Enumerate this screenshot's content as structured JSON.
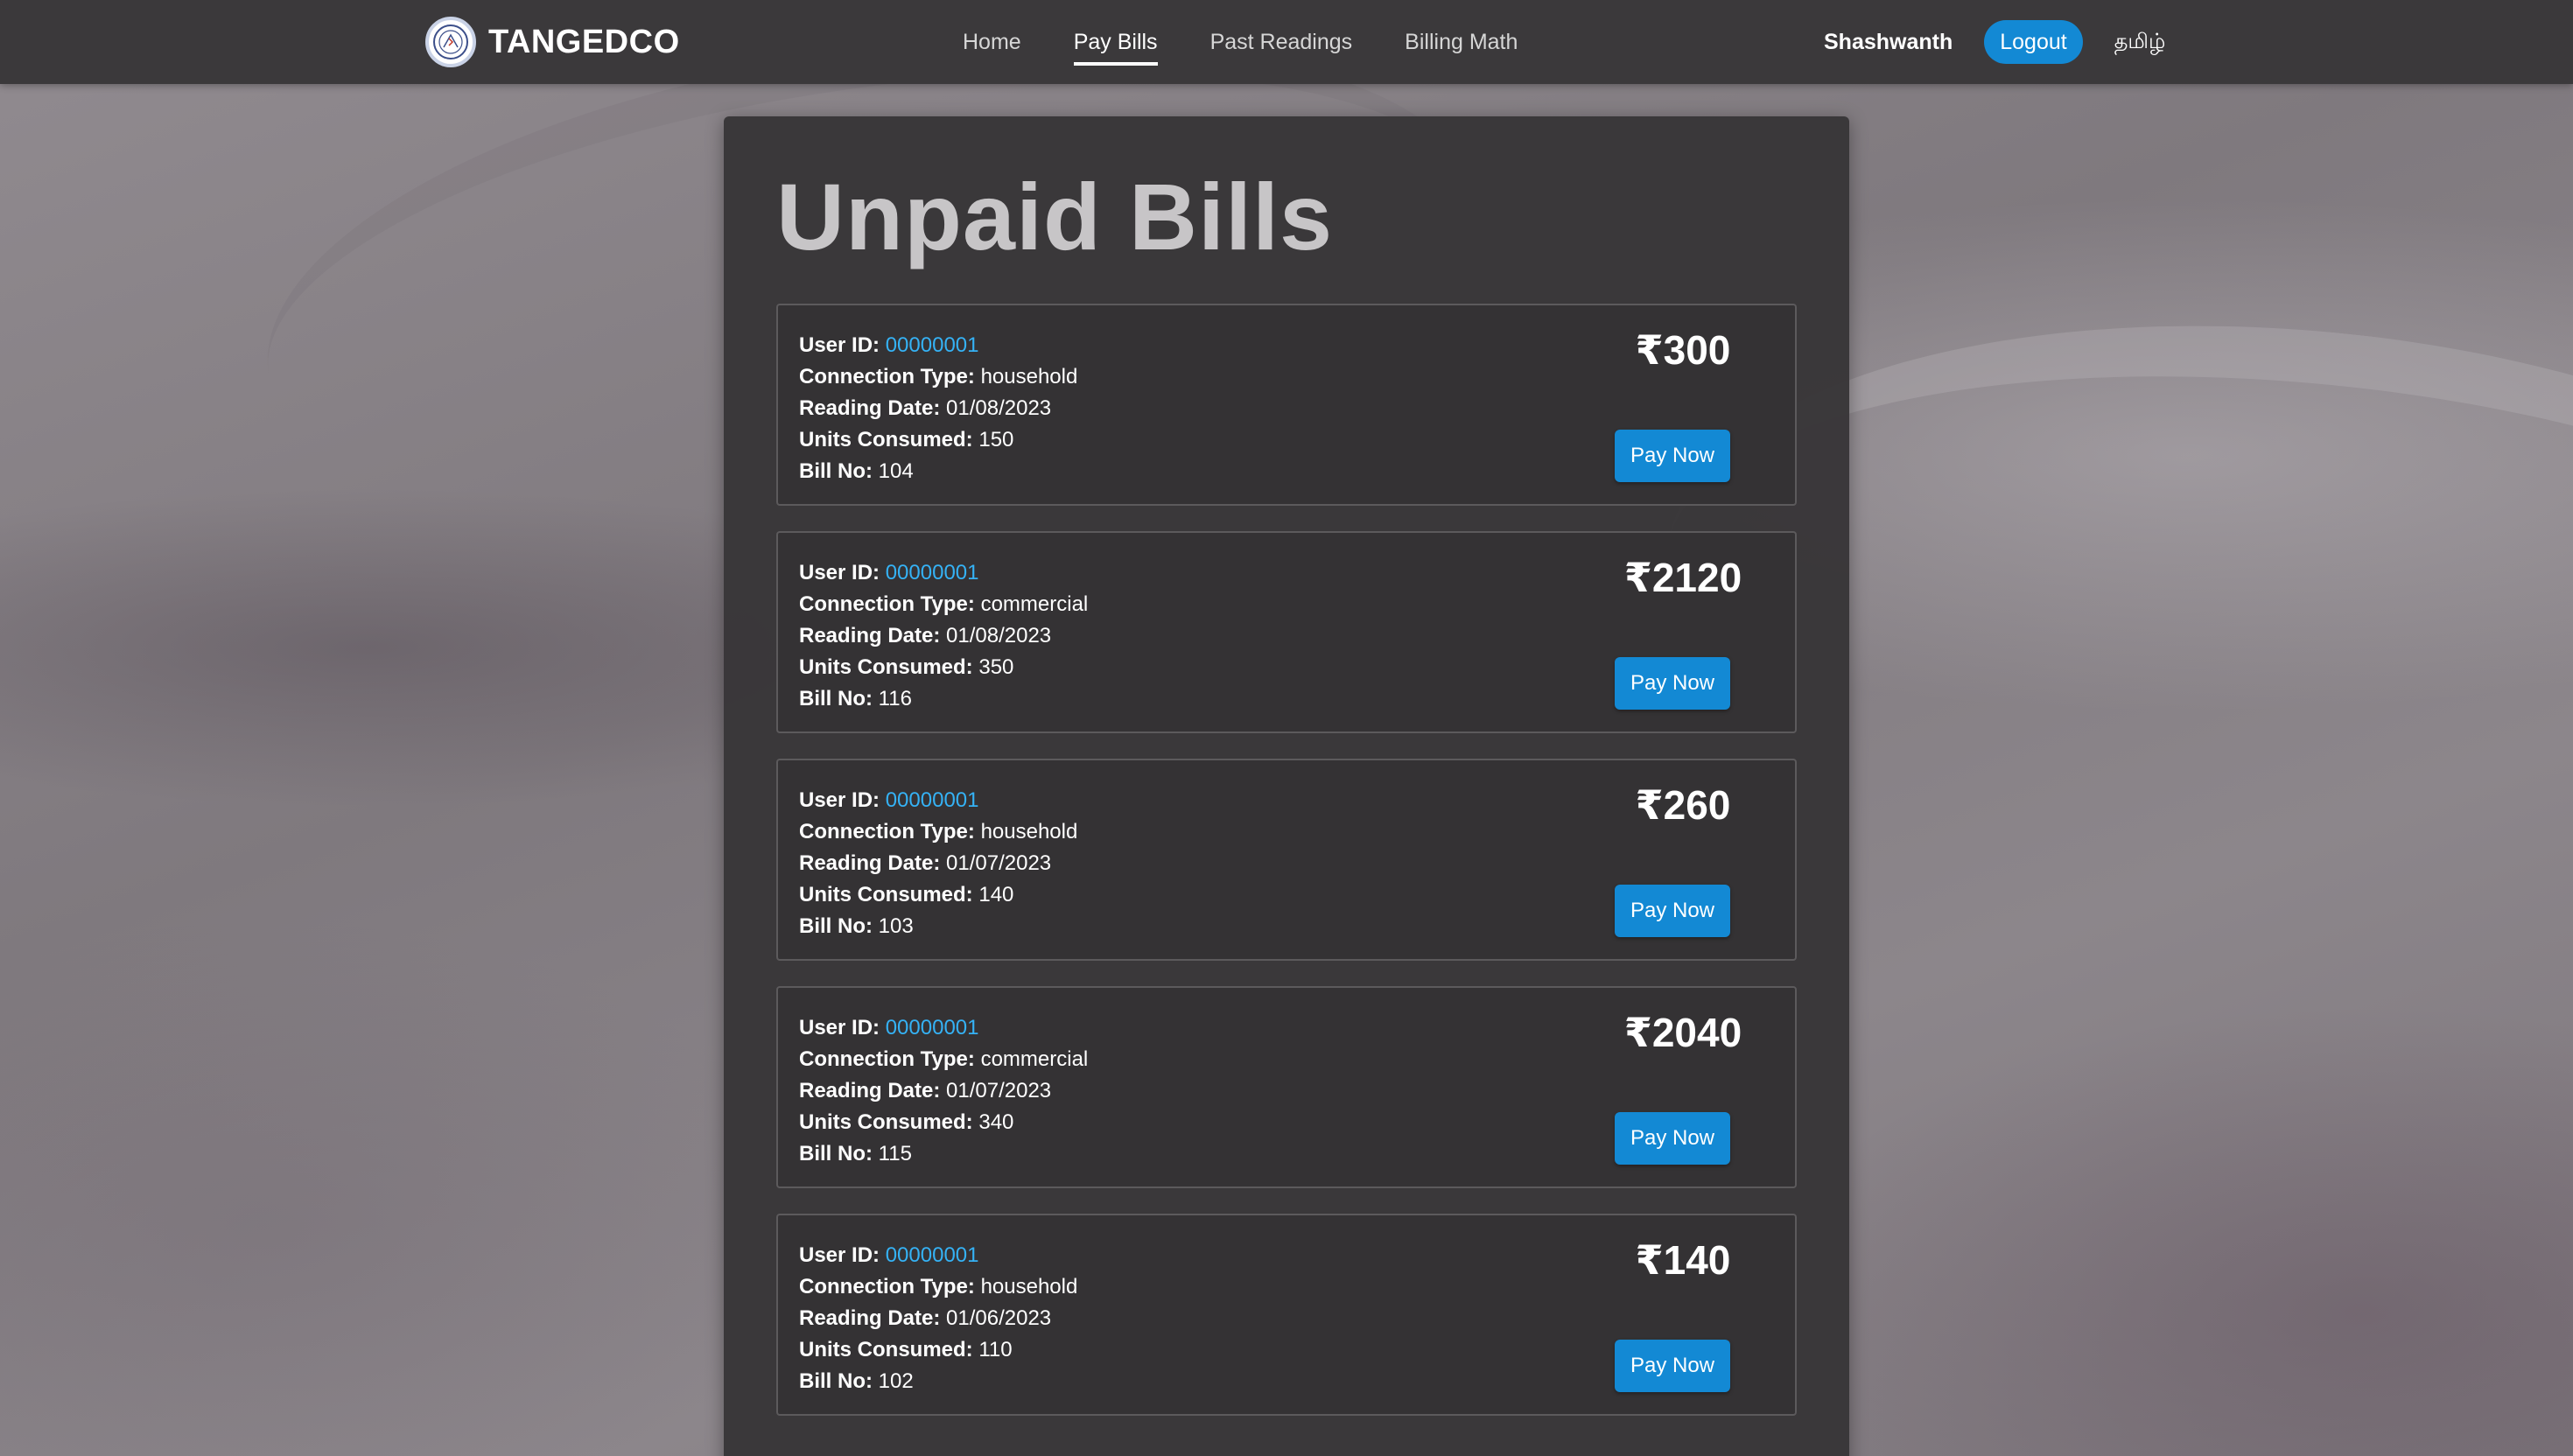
{
  "brand": {
    "name": "TANGEDCO",
    "logo_icon": "tangedco-logo-icon"
  },
  "nav": {
    "links": [
      {
        "label": "Home"
      },
      {
        "label": "Pay Bills",
        "active": true
      },
      {
        "label": "Past Readings"
      },
      {
        "label": "Billing Math"
      }
    ],
    "username": "Shashwanth",
    "logout_label": "Logout",
    "language_label": "தமிழ்"
  },
  "colors": {
    "accent": "#1389d4",
    "user_id_link": "#35b2f5"
  },
  "page": {
    "title": "Unpaid Bills"
  },
  "labels": {
    "user_id": "User ID:",
    "connection_type": "Connection Type:",
    "reading_date": "Reading Date:",
    "units_consumed": "Units Consumed:",
    "bill_no": "Bill No:",
    "pay_now": "Pay Now"
  },
  "bills": [
    {
      "user_id": "00000001",
      "connection_type": "household",
      "reading_date": "01/08/2023",
      "units_consumed": "150",
      "bill_no": "104",
      "amount": "₹300"
    },
    {
      "user_id": "00000001",
      "connection_type": "commercial",
      "reading_date": "01/08/2023",
      "units_consumed": "350",
      "bill_no": "116",
      "amount": "₹2120"
    },
    {
      "user_id": "00000001",
      "connection_type": "household",
      "reading_date": "01/07/2023",
      "units_consumed": "140",
      "bill_no": "103",
      "amount": "₹260"
    },
    {
      "user_id": "00000001",
      "connection_type": "commercial",
      "reading_date": "01/07/2023",
      "units_consumed": "340",
      "bill_no": "115",
      "amount": "₹2040"
    },
    {
      "user_id": "00000001",
      "connection_type": "household",
      "reading_date": "01/06/2023",
      "units_consumed": "110",
      "bill_no": "102",
      "amount": "₹140"
    }
  ]
}
